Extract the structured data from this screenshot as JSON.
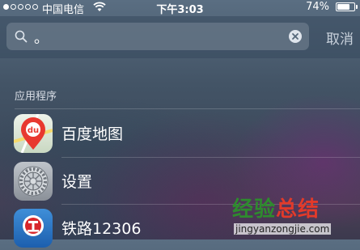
{
  "status_bar": {
    "carrier": "中国电信",
    "time": "下午3:03",
    "battery_percent": "74%",
    "battery_level": 0.74,
    "signal_bars": 1,
    "signal_total": 5
  },
  "search": {
    "query": "。",
    "cancel_label": "取消"
  },
  "results": {
    "section_title": "应用程序",
    "apps": [
      {
        "label": "百度地图",
        "icon": "baidu-maps-icon"
      },
      {
        "label": "设置",
        "icon": "settings-gear-icon"
      },
      {
        "label": "铁路12306",
        "icon": "railway-12306-icon"
      }
    ]
  },
  "watermark": {
    "title_part1": "经验",
    "title_part2": "总结",
    "url": "jingyanzongjie.com"
  },
  "colors": {
    "watermark_green": "#2e8b2e",
    "watermark_red": "#e23a2a",
    "baidu_red": "#e8382f"
  }
}
